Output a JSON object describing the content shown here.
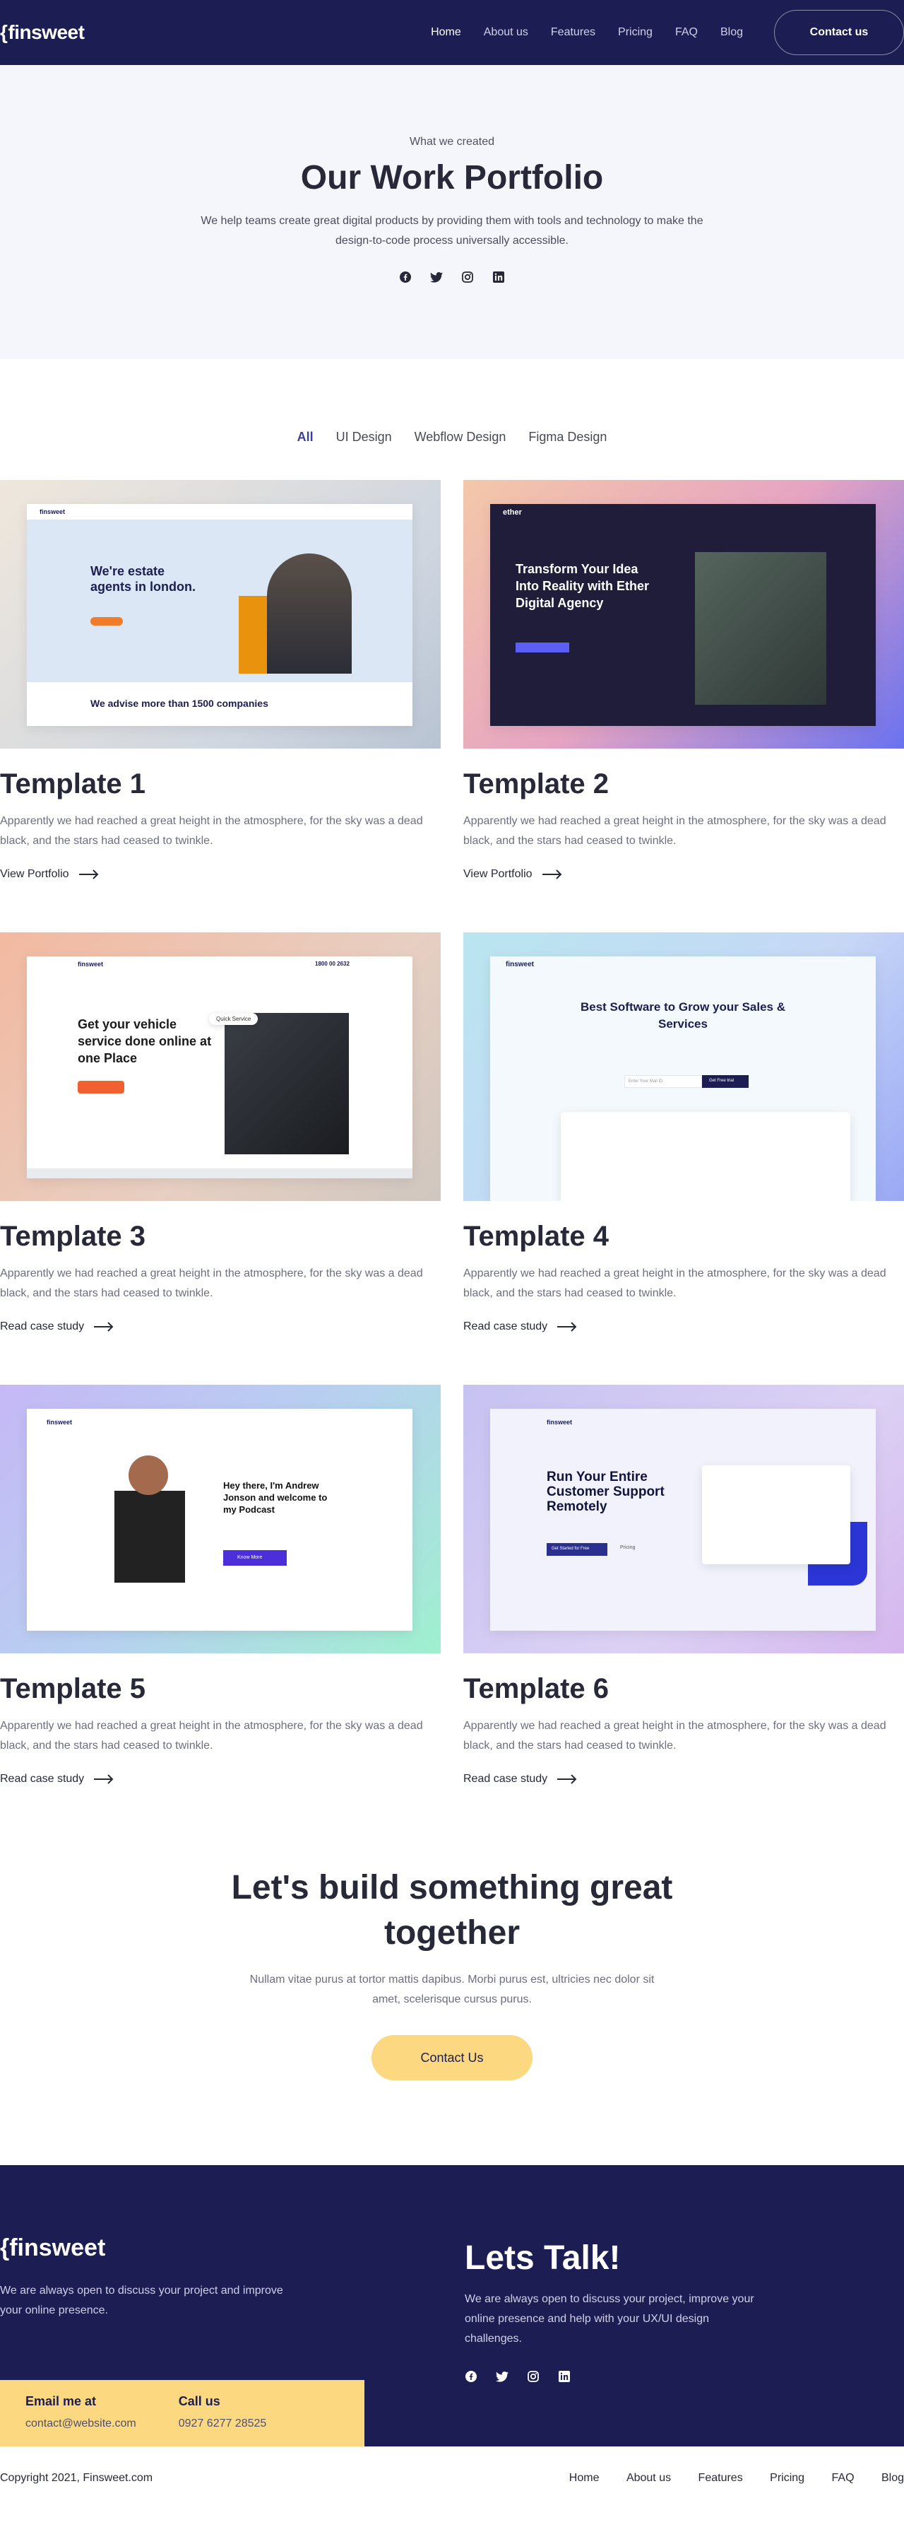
{
  "nav": {
    "logo": "finsweet",
    "links": [
      "Home",
      "About us",
      "Features",
      "Pricing",
      "FAQ",
      "Blog"
    ],
    "cta": "Contact us"
  },
  "hero": {
    "eyebrow": "What we created",
    "title": "Our Work Portfolio",
    "text": "We help teams create great digital products by providing them with tools and technology to make the design-to-code process universally accessible."
  },
  "filters": [
    "All",
    "UI Design",
    "Webflow Design",
    "Figma Design"
  ],
  "templates": [
    {
      "title": "Template 1",
      "text": "Apparently we had reached a great height in the atmosphere, for the sky was a dead black, and the stars had ceased to twinkle.",
      "link": "View Portfolio",
      "preview": {
        "logo": "finsweet",
        "headline": "We're estate agents in london.",
        "footer": "We advise more than 1500 companies"
      }
    },
    {
      "title": "Template 2",
      "text": "Apparently we had reached a great height in the atmosphere, for the sky was a dead black, and the stars had ceased to twinkle.",
      "link": "View Portfolio",
      "preview": {
        "logo": "ether",
        "headline": "Transform Your Idea Into Reality with Ether Digital Agency"
      }
    },
    {
      "title": "Template 3",
      "text": "Apparently we had reached a great height in the atmosphere, for the sky was a dead black, and the stars had ceased to twinkle.",
      "link": "Read case study",
      "preview": {
        "logo": "finsweet",
        "headline": "Get your vehicle service done online at one Place",
        "badge": "Quick Service",
        "phone": "1800 00 2632"
      }
    },
    {
      "title": "Template 4",
      "text": "Apparently we had reached a great height in the atmosphere, for the sky was a dead black, and the stars had ceased to twinkle.",
      "link": "Read case study",
      "preview": {
        "logo": "finsweet",
        "headline": "Best Software to Grow your Sales & Services",
        "input": "Enter Your Mail ID",
        "button": "Get Free trial"
      }
    },
    {
      "title": "Template 5",
      "text": "Apparently we had reached a great height in the atmosphere, for the sky was a dead black, and the stars had ceased to twinkle.",
      "link": "Read case study",
      "preview": {
        "logo": "finsweet",
        "headline": "Hey there, I'm Andrew Jonson and welcome to my Podcast",
        "button": "Know More"
      }
    },
    {
      "title": "Template 6",
      "text": "Apparently we had reached a great height in the atmosphere, for the sky was a dead black, and the stars had ceased to twinkle.",
      "link": "Read case study",
      "preview": {
        "logo": "finsweet",
        "headline": "Run Your Entire Customer Support Remotely",
        "button": "Get Started for Free",
        "secondary": "Pricing"
      }
    }
  ],
  "cta": {
    "title": "Let's build something great together",
    "text": "Nullam vitae purus at tortor mattis dapibus. Morbi purus est, ultricies nec dolor sit amet, scelerisque cursus purus.",
    "button": "Contact Us"
  },
  "footer": {
    "logo": "finsweet",
    "text": "We are always open to discuss your project and improve your online presence.",
    "talk_title": "Lets Talk!",
    "talk_text": "We are always open to discuss your project, improve your online presence and help with your UX/UI design challenges.",
    "email_label": "Email me at",
    "email": "contact@website.com",
    "call_label": "Call us",
    "phone": "0927 6277 28525",
    "copyright": "Copyright 2021, Finsweet.com",
    "links": [
      "Home",
      "About us",
      "Features",
      "Pricing",
      "FAQ",
      "Blog"
    ]
  },
  "colors": {
    "navy": "#1c1e53",
    "yellow": "#fcd980",
    "accent": "#4d5ae5",
    "hero_bg": "#f4f6fc"
  },
  "icons": {
    "socials": [
      "facebook-icon",
      "twitter-icon",
      "instagram-icon",
      "linkedin-icon"
    ],
    "arrow": "arrow-right-icon"
  }
}
